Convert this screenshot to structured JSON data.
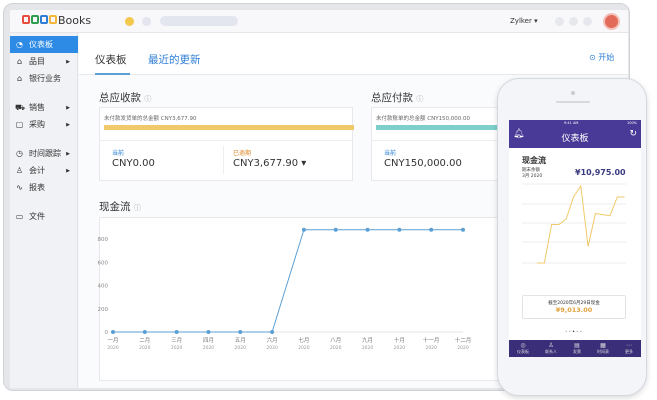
{
  "app": {
    "brand": "Books",
    "logo_colors": [
      "#e74c3c",
      "#2e9e4f",
      "#2e7ed6",
      "#f3b73b"
    ],
    "user": "Zylker ▾"
  },
  "sidebar": {
    "items": [
      {
        "label": "仪表板",
        "icon": "dashboard-icon",
        "active": true,
        "arrow": false
      },
      {
        "label": "品目",
        "icon": "basket-icon",
        "arrow": true
      },
      {
        "label": "银行业务",
        "icon": "bank-icon",
        "arrow": false
      },
      {
        "label": "销售",
        "icon": "cart-icon",
        "arrow": true
      },
      {
        "label": "采购",
        "icon": "bag-icon",
        "arrow": true
      },
      {
        "label": "时间跟踪",
        "icon": "timer-icon",
        "arrow": true
      },
      {
        "label": "会计",
        "icon": "accountant-icon",
        "arrow": true
      },
      {
        "label": "报表",
        "icon": "report-icon",
        "arrow": false
      },
      {
        "label": "文件",
        "icon": "folder-icon",
        "arrow": false
      }
    ]
  },
  "tabs": [
    {
      "label": "仪表板",
      "active": true
    },
    {
      "label": "最近的更新",
      "active": false
    }
  ],
  "start_label": "开始",
  "receivables": {
    "title": "总应收款",
    "unpaid_text": "未付款发货单的总金额 CNY3,677.90",
    "bar_color": "#f0c96a",
    "current_label": "当前",
    "current_value": "CNY0.00",
    "overdue_label": "已逾期",
    "overdue_value": "CNY3,677.90 ▾"
  },
  "payables": {
    "title": "总应付款",
    "unpaid_text": "未付款账单的总金额 CNY150,000.00",
    "bar_color": "#7dcfcb",
    "current_label": "当前",
    "current_value": "CNY150,000.00"
  },
  "cashflow": {
    "title": "现金流"
  },
  "chart_data": {
    "type": "line",
    "categories": [
      "一月 2020",
      "二月 2020",
      "三月 2020",
      "四月 2020",
      "五月 2020",
      "六月 2020",
      "七月 2020",
      "八月 2020",
      "九月 2020",
      "十月 2020",
      "十一月 2020",
      "十二月 2020"
    ],
    "month_labels": [
      "一月",
      "二月",
      "三月",
      "四月",
      "五月",
      "六月",
      "七月",
      "八月",
      "九月",
      "十月",
      "十一月",
      "十二月"
    ],
    "year_label": "2020",
    "values": [
      0,
      0,
      0,
      0,
      0,
      0,
      880,
      880,
      880,
      880,
      880,
      880
    ],
    "yticks": [
      0,
      200,
      400,
      600,
      800
    ],
    "ylim": [
      0,
      900
    ],
    "color": "#5b9fd3",
    "grid": false
  },
  "phone": {
    "status_time": "9:41 AM",
    "battery": "100%",
    "title": "仪表板",
    "card_title": "现金流",
    "balance_label": "期末余额",
    "balance_period": "3月 2020",
    "balance_value": "¥10,975.00",
    "cash_label": "截至2020年6月29日现金",
    "cash_value": "¥9,013.00",
    "trend": [
      0,
      0,
      3.5,
      3.5,
      4,
      6,
      7,
      1.5,
      4.5,
      4.4,
      4.3,
      6,
      6
    ],
    "nav": [
      {
        "label": "仪表板",
        "icon": "dashboard-icon"
      },
      {
        "label": "联系人",
        "icon": "contacts-icon"
      },
      {
        "label": "发票",
        "icon": "invoice-icon"
      },
      {
        "label": "时间表",
        "icon": "timesheet-icon"
      },
      {
        "label": "更多",
        "icon": "more-icon"
      }
    ]
  }
}
